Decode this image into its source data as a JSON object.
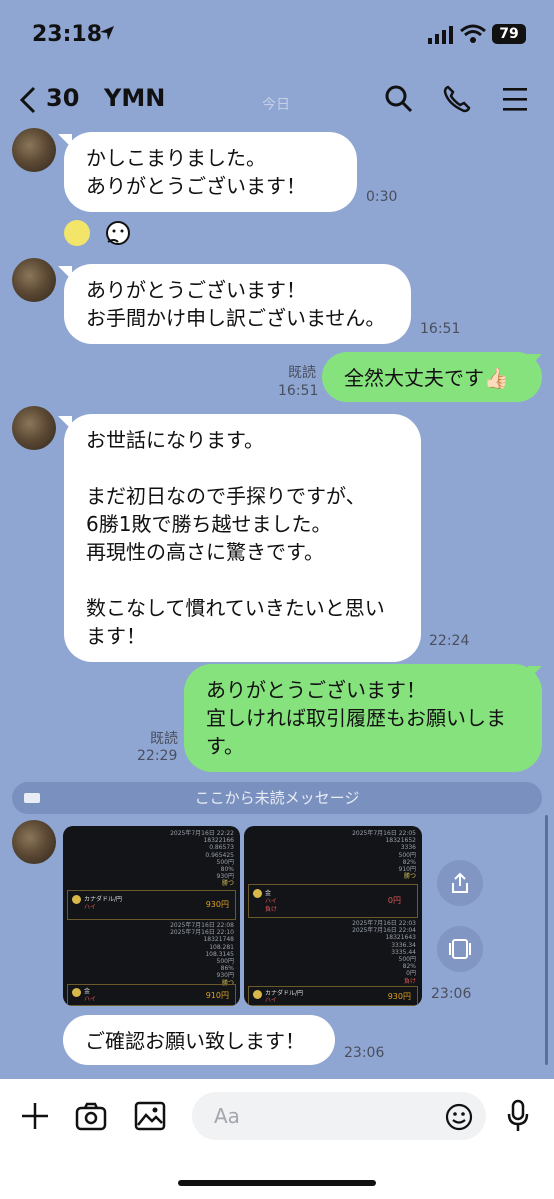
{
  "status": {
    "time": "23:18",
    "battery": "79"
  },
  "header": {
    "unread_count": "30",
    "name": "YMN",
    "date_chip": "今日"
  },
  "messages": {
    "m1": {
      "text": "かしこまりました。\nありがとうございます！",
      "time": "0:30"
    },
    "m2": {
      "text": "ありがとうございます！\nお手間かけ申し訳ございません。",
      "time": "16:51"
    },
    "m3": {
      "text": "全然大丈夫です👍🏻",
      "read": "既読",
      "time": "16:51"
    },
    "m4": {
      "text": "お世話になります。\n\nまだ初日なので手探りですが、\n6勝1敗で勝ち越せました。\n再現性の高さに驚きです。\n\n数こなして慣れていきたいと思います！",
      "time": "22:24"
    },
    "m5": {
      "text": "ありがとうございます！\n宜しければ取引履歴もお願いします。",
      "read": "既読",
      "time": "22:29"
    },
    "unread_divider": "ここから未読メッセージ",
    "images_time": "23:06",
    "m6": {
      "text": "ご確認お願い致します！",
      "time": "23:06"
    }
  },
  "shot_left": {
    "date_top": "2025年7月16日 22:22",
    "id_top": "18322166",
    "v1": "0.86573",
    "v2": "0.965425",
    "stake": "500円",
    "payout": "80%",
    "refund": "930円",
    "status1": "勝つ",
    "pair": "カナダドル/円",
    "dir": "ハイ",
    "amount": "930円",
    "date_b1": "2025年7月16日 22:08",
    "date_b2": "2025年7月16日 22:10",
    "id_b": "18321748",
    "v3": "108.281",
    "v4": "108.3145",
    "stake2": "500円",
    "payout2": "86%",
    "refund2": "930円",
    "status2": "勝つ",
    "pair2": "金",
    "dir2": "ハイ",
    "amount2": "910円"
  },
  "shot_right": {
    "date_top": "2025年7月16日 22:05",
    "id_top": "18321652",
    "v1": "3336",
    "stake": "500円",
    "payout": "82%",
    "refund": "910円",
    "status1": "勝つ",
    "pair": "金",
    "dir": "ハイ",
    "status_red": "負け",
    "amount": "0円",
    "date_b1": "2025年7月16日 22:03",
    "date_b2": "2025年7月16日 22:04",
    "id_b": "18321643",
    "v3": "3336.34",
    "v4": "3335.44",
    "stake2": "500円",
    "payout2": "82%",
    "refund2": "0円",
    "status2": "負け",
    "pair2": "カナダドル/円",
    "dir2": "ハイ",
    "amount2": "930円"
  },
  "composer": {
    "placeholder": "Aa"
  },
  "colors": {
    "chat_bg": "#8fa6d3",
    "own_bubble": "#86e27d",
    "other_bubble": "#ffffff"
  }
}
